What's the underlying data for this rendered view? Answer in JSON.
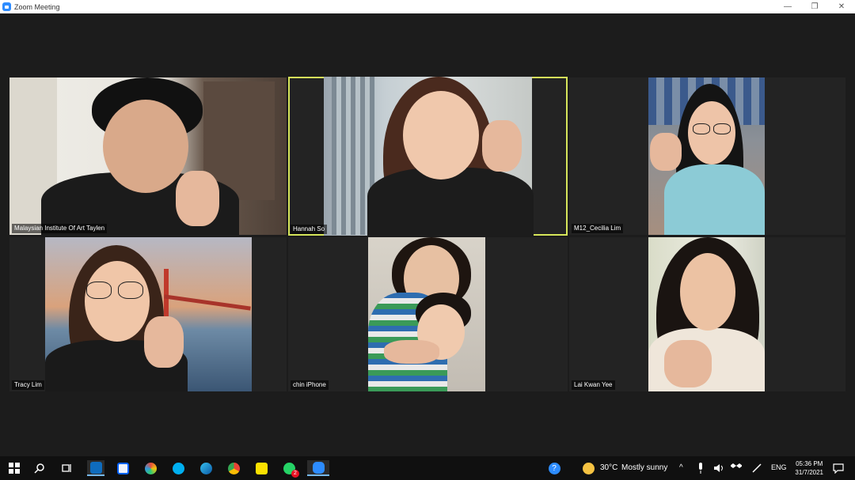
{
  "window": {
    "title": "Zoom Meeting",
    "controls": {
      "minimize": "—",
      "maximize": "❐",
      "close": "✕"
    }
  },
  "participants": [
    {
      "name": "Malaysian Institute Of Art Taylen",
      "active": false
    },
    {
      "name": "Hannah So",
      "active": true
    },
    {
      "name": "M12_Cecilia Lim",
      "active": false
    },
    {
      "name": "Tracy Lim",
      "active": false
    },
    {
      "name": "chin iPhone",
      "active": false
    },
    {
      "name": "Lai Kwan Yee",
      "active": false
    }
  ],
  "taskbar": {
    "start_icon": "windows-start-icon",
    "apps": [
      "search-icon",
      "task-view-icon",
      "outlook-icon",
      "dropbox-icon",
      "paint-icon",
      "skype-icon",
      "edge-icon",
      "chrome-icon",
      "sticky-notes-icon",
      "whatsapp-icon",
      "zoom-icon"
    ],
    "whatsapp_badge": "2",
    "weather": {
      "temp": "30°C",
      "condition": "Mostly sunny"
    },
    "tray": {
      "help": "?",
      "chevron": "^",
      "language": "ENG"
    },
    "clock": {
      "time": "05:36 PM",
      "date": "31/7/2021"
    }
  },
  "colors": {
    "active_speaker_border": "#d6e65a",
    "taskbar_bg": "#101010",
    "stage_bg": "#1c1c1c"
  }
}
